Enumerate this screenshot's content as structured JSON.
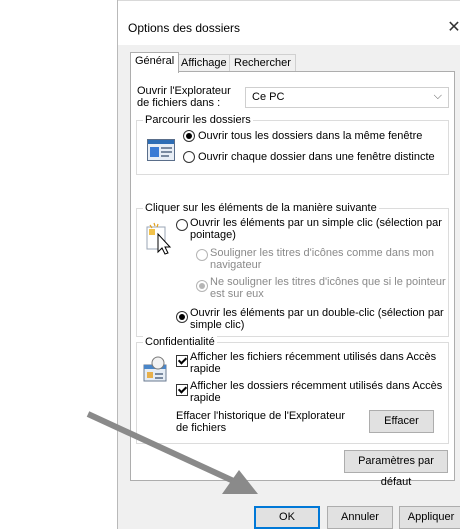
{
  "window": {
    "title": "Options des dossiers",
    "close_glyph": "✕"
  },
  "tabs": [
    {
      "label": "Général",
      "active": true
    },
    {
      "label": "Affichage",
      "active": false
    },
    {
      "label": "Rechercher",
      "active": false
    }
  ],
  "open_explorer": {
    "label": "Ouvrir l'Explorateur de fichiers dans :",
    "label_line1": "Ouvrir l'Explorateur",
    "label_line2": "de fichiers dans :",
    "value": "Ce PC"
  },
  "browse_folders": {
    "legend": "Parcourir les dossiers",
    "options": [
      {
        "label": "Ouvrir tous les dossiers dans la même fenêtre",
        "checked": true
      },
      {
        "label": "Ouvrir chaque dossier dans une fenêtre distincte",
        "checked": false
      }
    ]
  },
  "click_items": {
    "legend": "Cliquer sur les éléments de la manière suivante",
    "single_click": {
      "line1": "Ouvrir les éléments par un simple clic (sélection par",
      "line2": "pointage)",
      "checked": false
    },
    "underline_browser": {
      "line1": "Souligner les titres d'icônes comme dans mon",
      "line2": "navigateur",
      "checked": false,
      "disabled": true
    },
    "underline_hover": {
      "line1": "Ne souligner les titres d'icônes que si le pointeur",
      "line2": "est sur eux",
      "checked": true,
      "disabled": true
    },
    "double_click": {
      "line1": "Ouvrir les éléments par un double-clic (sélection par",
      "line2": "simple clic)",
      "checked": true
    }
  },
  "privacy": {
    "legend": "Confidentialité",
    "recent_files": {
      "line1": "Afficher les fichiers récemment utilisés dans Accès",
      "line2": "rapide",
      "checked": true
    },
    "recent_folders": {
      "line1": "Afficher les dossiers récemment utilisés dans Accès",
      "line2": "rapide",
      "checked": true
    },
    "clear_history": {
      "line1": "Effacer l'historique de l'Explorateur",
      "line2": "de fichiers"
    },
    "clear_button": "Effacer"
  },
  "restore_defaults_button": "Paramètres par défaut",
  "footer": {
    "ok": "OK",
    "cancel": "Annuler",
    "apply": "Appliquer"
  },
  "colors": {
    "accent": "#0078d7",
    "arrow": "#8a8a8a",
    "dialog_bg": "#f0f0f0"
  }
}
